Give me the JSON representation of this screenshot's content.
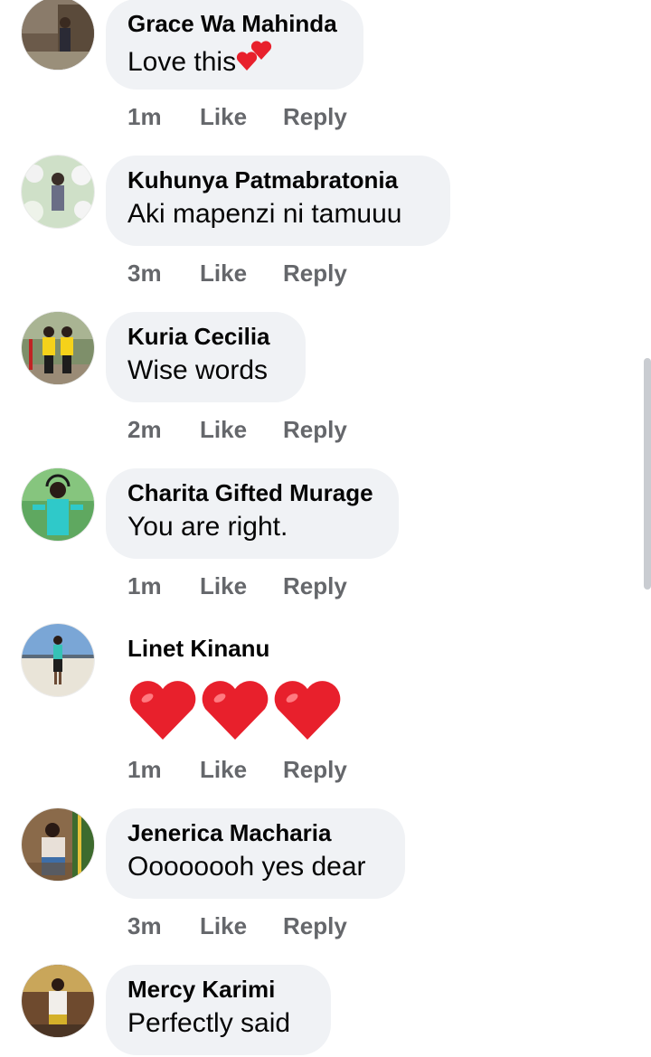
{
  "comments": [
    {
      "author": "Grace Wa Mahinda",
      "text": "Love this",
      "emoji": "two-hearts",
      "time": "1m",
      "like": "Like",
      "reply": "Reply",
      "avatar": "avatar-photo-grace"
    },
    {
      "author": "Kuhunya Patmabratonia",
      "text": "Aki mapenzi ni tamuuu",
      "time": "3m",
      "like": "Like",
      "reply": "Reply",
      "avatar": "avatar-photo-kuhunya"
    },
    {
      "author": "Kuria Cecilia",
      "text": "Wise words",
      "time": "2m",
      "like": "Like",
      "reply": "Reply",
      "avatar": "avatar-photo-kuria"
    },
    {
      "author": "Charita Gifted Murage",
      "text": "You are right.",
      "time": "1m",
      "like": "Like",
      "reply": "Reply",
      "avatar": "avatar-photo-charita"
    },
    {
      "author": "Linet Kinanu",
      "text": "",
      "emoji": "three-red-hearts",
      "time": "1m",
      "like": "Like",
      "reply": "Reply",
      "avatar": "avatar-photo-linet"
    },
    {
      "author": "Jenerica Macharia",
      "text": "Oooooooh yes dear",
      "time": "3m",
      "like": "Like",
      "reply": "Reply",
      "avatar": "avatar-photo-jenerica"
    },
    {
      "author": "Mercy Karimi",
      "text": "Perfectly said",
      "time": "",
      "like": "",
      "reply": "",
      "avatar": "avatar-photo-mercy"
    }
  ],
  "colors": {
    "bubble": "#f0f2f5",
    "meta": "#65676b",
    "text": "#050505",
    "heart": "#e8202c"
  }
}
